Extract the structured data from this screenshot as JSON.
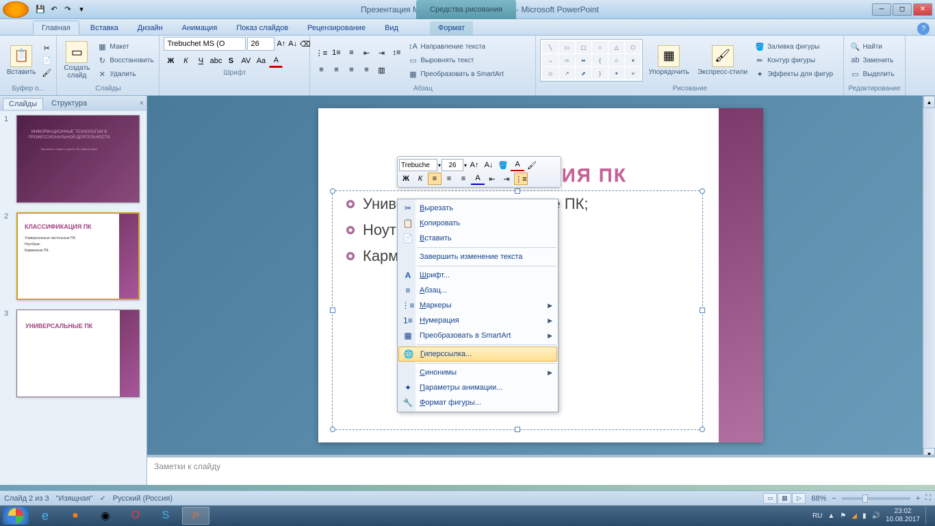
{
  "window": {
    "title": "Презентация Microsoft Office PowerPoint - Microsoft PowerPoint",
    "contextual_tab": "Средства рисования"
  },
  "ribbon": {
    "tabs": [
      "Главная",
      "Вставка",
      "Дизайн",
      "Анимация",
      "Показ слайдов",
      "Рецензирование",
      "Вид",
      "Формат"
    ],
    "active_tab": 0,
    "groups": {
      "clipboard": {
        "label": "Буфер о...",
        "paste": "Вставить"
      },
      "slides": {
        "label": "Слайды",
        "new_slide": "Создать\nслайд",
        "layout": "Макет",
        "reset": "Восстановить",
        "delete": "Удалить"
      },
      "font": {
        "label": "Шрифт",
        "name": "Trebuchet MS (О",
        "size": "26"
      },
      "paragraph": {
        "label": "Абзац",
        "text_direction": "Направление текста",
        "align_text": "Выровнять текст",
        "convert_smartart": "Преобразовать в SmartArt"
      },
      "drawing": {
        "label": "Рисование",
        "arrange": "Упорядочить",
        "quick_styles": "Экспресс-стили",
        "fill": "Заливка фигуры",
        "outline": "Контур фигуры",
        "effects": "Эффекты для фигур"
      },
      "editing": {
        "label": "Редактирование",
        "find": "Найти",
        "replace": "Заменить",
        "select": "Выделить"
      }
    }
  },
  "slide_panel": {
    "tabs": [
      "Слайды",
      "Структура"
    ],
    "thumbs": [
      {
        "num": "1",
        "title": "ИНФОРМАЦИОННЫЕ ТЕХНОЛОГИИ В ПРОФЕССИОНАЛЬНОЙ ДЕЯТЕЛЬНОСТИ",
        "sub": "Выполнил: студент группы 18т Иванов Иван"
      },
      {
        "num": "2",
        "title": "КЛАССИФИКАЦИЯ ПК",
        "body": "Универсальные настольные ПК;\nНоутбуки;\nКарманные ПК."
      },
      {
        "num": "3",
        "title": "УНИВЕРСАЛЬНЫЕ ПК"
      }
    ],
    "selected": 1
  },
  "slide": {
    "title": "КЛАССИФИКАЦИЯ ПК",
    "bullets": [
      "Универсальные настольные ПК;",
      "Ноутбуки;",
      "Карманные ПК."
    ],
    "bullets_visible": [
      "Универсальные настольные ПК;",
      "Ноутб",
      "Карма"
    ]
  },
  "mini_toolbar": {
    "font": "Trebuche",
    "size": "26"
  },
  "context_menu": {
    "items": [
      {
        "icon": "✂",
        "label": "Вырезать",
        "u": "В"
      },
      {
        "icon": "📋",
        "label": "Копировать",
        "u": "К"
      },
      {
        "icon": "📄",
        "label": "Вставить",
        "u": "В"
      },
      {
        "sep": true
      },
      {
        "icon": "",
        "label": "Завершить изменение текста"
      },
      {
        "sep": true
      },
      {
        "icon": "A",
        "label": "Шрифт...",
        "u": "Ш"
      },
      {
        "icon": "≡",
        "label": "Абзац...",
        "u": "А"
      },
      {
        "icon": "⋮≡",
        "label": "Маркеры",
        "u": "М",
        "arrow": true
      },
      {
        "icon": "1≡",
        "label": "Нумерация",
        "u": "Н",
        "arrow": true
      },
      {
        "icon": "▦",
        "label": "Преобразовать в SmartArt",
        "arrow": true
      },
      {
        "sep": true
      },
      {
        "icon": "🌐",
        "label": "Гиперссылка...",
        "u": "Г",
        "hover": true
      },
      {
        "sep": true
      },
      {
        "icon": "",
        "label": "Синонимы",
        "u": "С",
        "arrow": true
      },
      {
        "icon": "✦",
        "label": "Параметры анимации...",
        "u": "П"
      },
      {
        "icon": "🔧",
        "label": "Формат фигуры...",
        "u": "Ф"
      }
    ]
  },
  "notes": {
    "placeholder": "Заметки к слайду"
  },
  "status": {
    "slide_of": "Слайд 2 из 3",
    "theme": "\"Изящная\"",
    "language": "Русский (Россия)",
    "zoom": "68%"
  },
  "taskbar": {
    "lang": "RU",
    "time": "23:02",
    "date": "10.08.2017"
  }
}
